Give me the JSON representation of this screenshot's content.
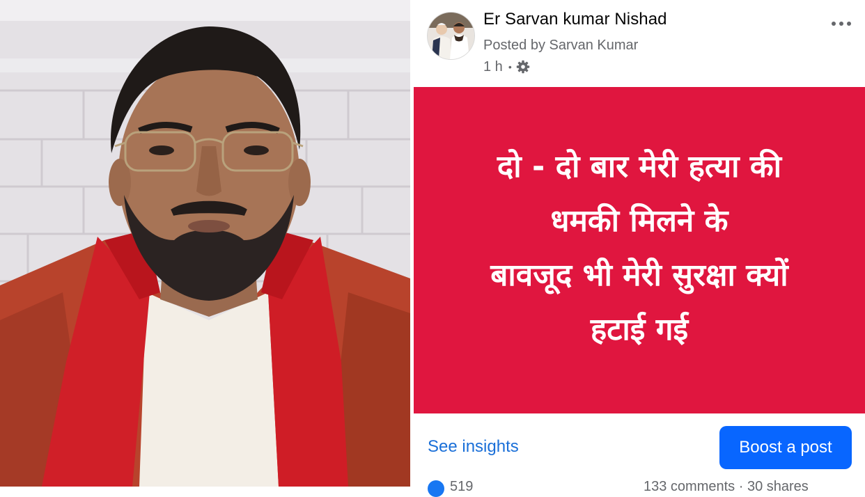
{
  "photo": {
    "description_icon": "person-portrait"
  },
  "post": {
    "page_name": "Er Sarvan kumar Nishad",
    "posted_by": "Posted by Sarvan Kumar",
    "time": "1 h",
    "privacy_icon": "gear-icon",
    "more_icon": "more-options-icon",
    "banner": {
      "background": "#e0163f",
      "lines": [
        "दो - दो बार मेरी हत्या की",
        "धमकी मिलने के",
        "बावजूद भी मेरी सुरक्षा क्यों",
        "हटाई गई"
      ]
    },
    "see_insights_label": "See insights",
    "boost_label": "Boost a post",
    "reactions_count": "519",
    "comments_shares": "133 comments · 30 shares",
    "colors": {
      "accent": "#0866ff",
      "link": "#1a6fd8"
    }
  }
}
